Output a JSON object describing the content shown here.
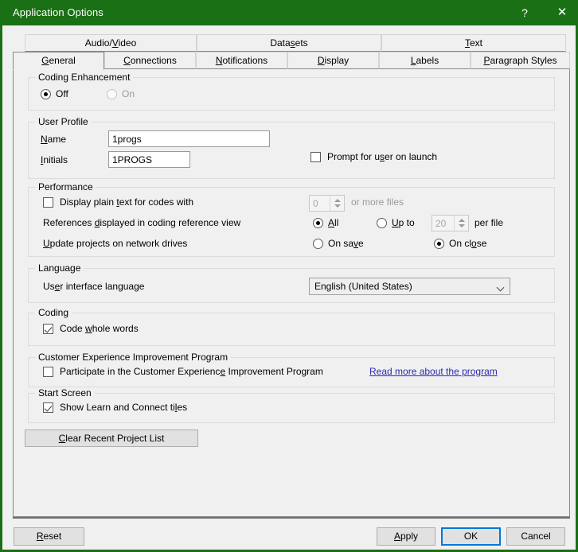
{
  "window": {
    "title": "Application Options",
    "accent_color": "#1a7014",
    "help_glyph": "?",
    "close_glyph": "✕"
  },
  "tabs": {
    "row_top": [
      {
        "label": "Audio/Video",
        "mnemonic": "V",
        "selected": false
      },
      {
        "label": "Datasets",
        "mnemonic": "s",
        "selected": false
      },
      {
        "label": "Text",
        "mnemonic": "T",
        "selected": false
      }
    ],
    "row_bottom": [
      {
        "label": "General",
        "mnemonic": "G",
        "selected": true
      },
      {
        "label": "Connections",
        "mnemonic": "C",
        "selected": false
      },
      {
        "label": "Notifications",
        "mnemonic": "N",
        "selected": false
      },
      {
        "label": "Display",
        "mnemonic": "D",
        "selected": false
      },
      {
        "label": "Labels",
        "mnemonic": "L",
        "selected": false
      },
      {
        "label": "Paragraph Styles",
        "mnemonic": "P",
        "selected": false
      }
    ]
  },
  "coding_enhancement": {
    "group_title": "Coding Enhancement",
    "off_label": "Off",
    "off_selected": true,
    "on_label": "On",
    "on_selected": false,
    "on_disabled": true
  },
  "user_profile": {
    "group_title": "User Profile",
    "name_label": "Name",
    "name_mnemonic": "N",
    "name_value": "1progs",
    "initials_label": "Initials",
    "initials_mnemonic": "I",
    "initials_value": "1PROGS",
    "prompt_label": "Prompt for user on launch",
    "prompt_mnemonic": "s",
    "prompt_checked": false
  },
  "performance": {
    "group_title": "Performance",
    "plain_text_label": "Display plain text for codes with",
    "plain_text_checked": false,
    "plain_text_spin_value": "0",
    "plain_text_suffix": "or more files",
    "references_label": "References displayed in coding reference view",
    "references_all_label": "All",
    "references_all_selected": true,
    "references_upto_label": "Up to",
    "references_upto_selected": false,
    "references_upto_value": "20",
    "references_upto_suffix": "per file",
    "update_label": "Update projects on network drives",
    "update_onsave_label": "On save",
    "update_onsave_selected": false,
    "update_onclose_label": "On close",
    "update_onclose_selected": true
  },
  "language": {
    "group_title": "Language",
    "ui_language_label": "User interface language",
    "ui_language_value": "English (United States)",
    "ui_language_options": [
      "English (United States)"
    ]
  },
  "coding": {
    "group_title": "Coding",
    "whole_words_label": "Code whole words",
    "whole_words_checked": true
  },
  "ceip": {
    "group_title": "Customer Experience Improvement Program",
    "participate_label": "Participate in the Customer Experience Improvement Program",
    "participate_checked": false,
    "read_more_label": "Read more about the program"
  },
  "start_screen": {
    "group_title": "Start Screen",
    "show_tiles_label": "Show Learn and Connect tiles",
    "show_tiles_checked": true
  },
  "clear_recent": {
    "label": "Clear Recent Project List"
  },
  "footer": {
    "reset_label": "Reset",
    "apply_label": "Apply",
    "ok_label": "OK",
    "cancel_label": "Cancel",
    "focused_button": "OK",
    "focus_color": "#0078d7"
  }
}
